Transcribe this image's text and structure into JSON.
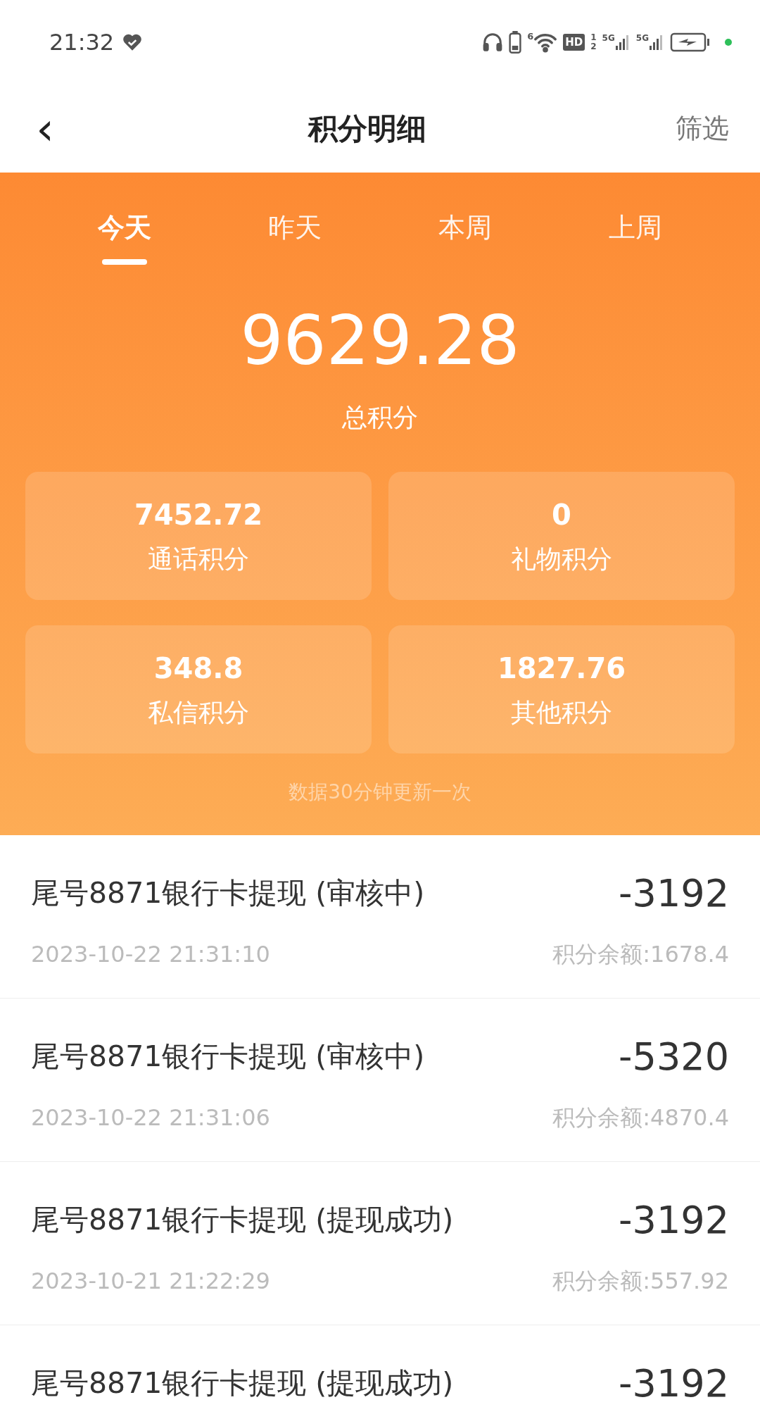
{
  "status_bar": {
    "time": "21:32",
    "wifi_badge": "6",
    "hd_badge": "HD",
    "sim_slots": [
      "1",
      "2"
    ],
    "network_labels": [
      "5G",
      "5G"
    ]
  },
  "header": {
    "back": "‹",
    "title": "积分明细",
    "action": "筛选"
  },
  "tabs": [
    {
      "label": "今天",
      "selected": true
    },
    {
      "label": "昨天",
      "selected": false
    },
    {
      "label": "本周",
      "selected": false
    },
    {
      "label": "上周",
      "selected": false
    }
  ],
  "total": {
    "value": "9629.28",
    "label": "总积分"
  },
  "stats": [
    {
      "value": "7452.72",
      "label": "通话积分"
    },
    {
      "value": "0",
      "label": "礼物积分"
    },
    {
      "value": "348.8",
      "label": "私信积分"
    },
    {
      "value": "1827.76",
      "label": "其他积分"
    }
  ],
  "update_note": "数据30分钟更新一次",
  "records": [
    {
      "title": "尾号8871银行卡提现 (审核中)",
      "amount": "-3192",
      "time": "2023-10-22 21:31:10",
      "balance": "积分余额:1678.4"
    },
    {
      "title": "尾号8871银行卡提现 (审核中)",
      "amount": "-5320",
      "time": "2023-10-22 21:31:06",
      "balance": "积分余额:4870.4"
    },
    {
      "title": "尾号8871银行卡提现 (提现成功)",
      "amount": "-3192",
      "time": "2023-10-21 21:22:29",
      "balance": "积分余额:557.92"
    },
    {
      "title": "尾号8871银行卡提现 (提现成功)",
      "amount": "-3192"
    }
  ]
}
